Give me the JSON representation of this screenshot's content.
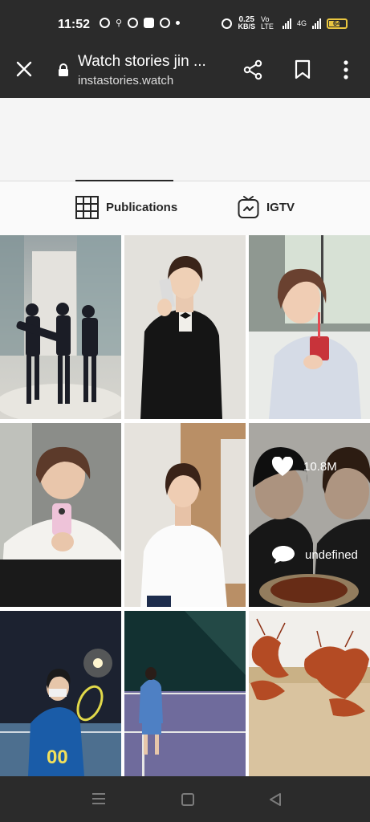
{
  "status_bar": {
    "time": "11:52",
    "net_speed_value": "0.25",
    "net_speed_unit": "KB/S",
    "volte": "Vo LTE",
    "network": "4G",
    "battery_level": "64",
    "battery_color": "#e9c640"
  },
  "browser": {
    "title": "Watch stories jin ...",
    "url": "instastories.watch",
    "close_icon": "close-icon",
    "share_icon": "share-icon",
    "bookmark_icon": "bookmark-icon",
    "menu_icon": "more-vert-icon"
  },
  "tabs": [
    {
      "label": "Publications",
      "icon": "grid-icon",
      "active": true
    },
    {
      "label": "IGTV",
      "icon": "igtv-icon",
      "active": false
    }
  ],
  "grid": {
    "overlay": {
      "likes": "10.8M",
      "comments": "undefined"
    }
  },
  "system_nav": [
    "menu-icon",
    "home-icon",
    "back-icon"
  ]
}
